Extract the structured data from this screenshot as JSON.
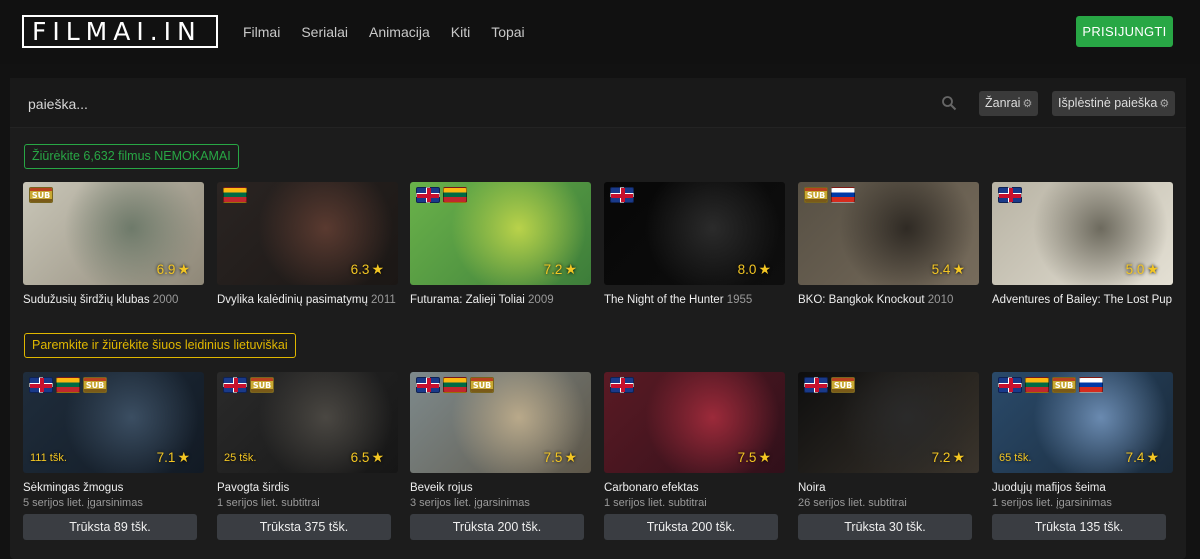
{
  "header": {
    "logo": "FILMAI.IN",
    "nav": [
      "Filmai",
      "Serialai",
      "Animacija",
      "Kiti",
      "Topai"
    ],
    "login_label": "PRISIJUNGTI"
  },
  "search": {
    "placeholder": "paieška...",
    "genres_label": "Žanrai",
    "advanced_label": "Išplėstinė paieška"
  },
  "free_banner": "Žiūrėkite 6,632 filmus NEMOKAMAI",
  "support_banner": "Paremkite ir žiūrėkite šiuos leidinius lietuviškai",
  "free_movies": [
    {
      "title": "Sudužusių širdžių klubas",
      "year": "2000",
      "rating": "6.9",
      "flags": [
        "sub"
      ],
      "colors": [
        "#c9c6b8",
        "#6e7a6a",
        "#8f8878"
      ]
    },
    {
      "title": "Dvylika kalėdinių pasimatymų",
      "year": "2011",
      "rating": "6.3",
      "flags": [
        "lt"
      ],
      "colors": [
        "#2a2422",
        "#5a3a30",
        "#1b1715"
      ]
    },
    {
      "title": "Futurama: Žalieji Toliai",
      "year": "2009",
      "rating": "7.2",
      "flags": [
        "gb",
        "lt"
      ],
      "colors": [
        "#6ab24a",
        "#b9d24a",
        "#3d7d3a"
      ]
    },
    {
      "title": "The Night of the Hunter",
      "year": "1955",
      "rating": "8.0",
      "flags": [
        "gb"
      ],
      "colors": [
        "#070707",
        "#2b2b2b",
        "#0e0e0e"
      ]
    },
    {
      "title": "BKO: Bangkok Knockout",
      "year": "2010",
      "rating": "5.4",
      "flags": [
        "sub",
        "ru"
      ],
      "colors": [
        "#575044",
        "#2f2a24",
        "#776c5c"
      ]
    },
    {
      "title": "Adventures of Bailey: The Lost Pup",
      "year": "",
      "rating": "5.0",
      "flags": [
        "gb"
      ],
      "colors": [
        "#b8b3a4",
        "#6d6a5e",
        "#e4e0d4"
      ]
    }
  ],
  "support_movies": [
    {
      "title": "Sėkmingas žmogus",
      "info": "5 serijos liet. įgarsinimas",
      "points": "111 tšk.",
      "rating": "7.1",
      "missing": "Trūksta 89 tšk.",
      "flags": [
        "gb",
        "lt",
        "sub"
      ],
      "colors": [
        "#1f2d3c",
        "#3b4e62",
        "#121a24"
      ]
    },
    {
      "title": "Pavogta širdis",
      "info": "1 serijos liet. subtitrai",
      "points": "25 tšk.",
      "rating": "6.5",
      "missing": "Trūksta 375 tšk.",
      "flags": [
        "gb",
        "sub"
      ],
      "colors": [
        "#2a2a2a",
        "#4a4742",
        "#161616"
      ]
    },
    {
      "title": "Beveik rojus",
      "info": "3 serijos liet. įgarsinimas",
      "points": "",
      "rating": "7.5",
      "missing": "Trūksta 200 tšk.",
      "flags": [
        "gb",
        "lt",
        "sub"
      ],
      "colors": [
        "#7e8a8c",
        "#b9a98a",
        "#5d5648"
      ]
    },
    {
      "title": "Carbonaro efektas",
      "info": "1 serijos liet. subtitrai",
      "points": "",
      "rating": "7.5",
      "missing": "Trūksta 200 tšk.",
      "flags": [
        "gb"
      ],
      "colors": [
        "#5a1a24",
        "#9c2a3a",
        "#30101a"
      ]
    },
    {
      "title": "Noira",
      "info": "26 serijos liet. subtitrai",
      "points": "",
      "rating": "7.2",
      "missing": "Trūksta 30 tšk.",
      "flags": [
        "gb",
        "sub"
      ],
      "colors": [
        "#0e0e0e",
        "#2a2a2a",
        "#3a342c"
      ]
    },
    {
      "title": "Juodųjų mafijos šeima",
      "info": "1 serijos liet. įgarsinimas",
      "points": "65 tšk.",
      "rating": "7.4",
      "missing": "Trūksta 135 tšk.",
      "flags": [
        "gb",
        "lt",
        "sub",
        "ru"
      ],
      "colors": [
        "#2a4a6a",
        "#6a8ab0",
        "#1a2a3a"
      ]
    }
  ],
  "icons": {
    "search": "search-icon",
    "gear": "gear-icon",
    "star": "star-icon"
  }
}
